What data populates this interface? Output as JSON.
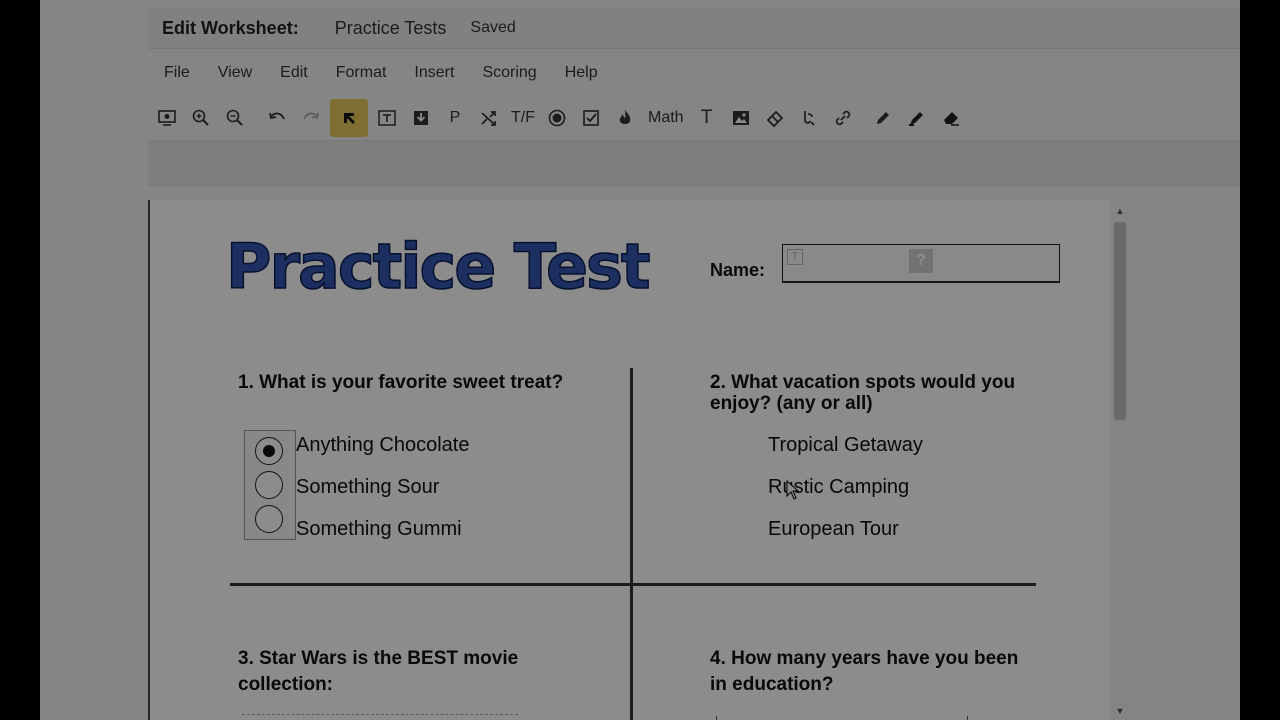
{
  "window": {
    "title_label": "Edit Worksheet:",
    "document_name": "Practice Tests",
    "save_status": "Saved"
  },
  "menu": [
    "File",
    "View",
    "Edit",
    "Format",
    "Insert",
    "Scoring",
    "Help"
  ],
  "toolbar": {
    "p_label": "P",
    "tf_label": "T/F",
    "math_label": "Math",
    "text_label": "T"
  },
  "worksheet": {
    "logo_text": "Practice Test",
    "name_label": "Name:",
    "name_value": "",
    "name_help_icon": "?",
    "q1": {
      "text": "1. What is your favorite sweet treat?",
      "options": [
        "Anything Chocolate",
        "Something Sour",
        "Something Gummi"
      ],
      "selected_index": 0
    },
    "q2": {
      "text": "2. What vacation spots would you enjoy? (any or all)",
      "options": [
        "Tropical Getaway",
        "Rustic Camping",
        "European Tour"
      ]
    },
    "q3": {
      "text": "3. Star Wars is the BEST movie collection:"
    },
    "q4": {
      "text": "4. How many years have you been in education?"
    }
  },
  "colors": {
    "logo_fill": "#3356b0",
    "logo_outline": "#0e1f55",
    "active_tool": "#e8c95a"
  },
  "icons": [
    "preview-icon",
    "zoom-in-icon",
    "zoom-out-icon",
    "undo-icon",
    "redo-icon",
    "select-arrow-icon",
    "text-box-icon",
    "download-icon",
    "paragraph-icon",
    "shuffle-icon",
    "true-false-icon",
    "radio-icon",
    "checkbox-icon",
    "fire-icon",
    "text-icon",
    "image-icon",
    "eraser-icon",
    "audio-icon",
    "link-icon",
    "pencil-icon",
    "marker-icon",
    "erase-ink-icon"
  ]
}
